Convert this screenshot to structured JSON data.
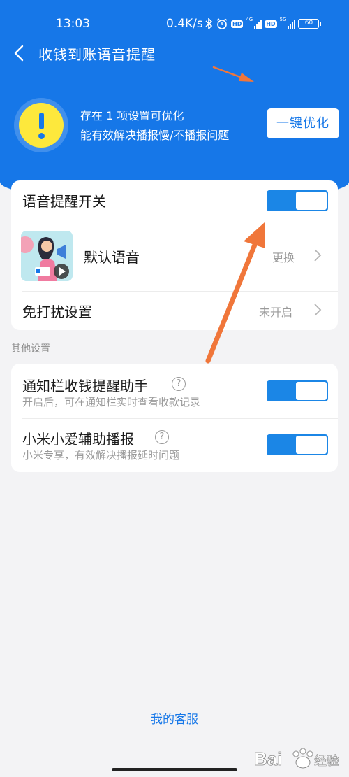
{
  "status_bar": {
    "time": "13:03",
    "speed": "0.4K/s",
    "network_1": "4G",
    "network_2": "5G",
    "hd_badge": "HD",
    "battery": "60"
  },
  "nav": {
    "title": "收钱到账语音提醒"
  },
  "alert": {
    "line1": "存在 1 项设置可优化",
    "line2": "能有效解决播报慢/不播报问题",
    "button_label": "一键优化"
  },
  "main_settings": {
    "voice_switch_label": "语音提醒开关",
    "voice_switch_on": true,
    "default_voice_label": "默认语音",
    "change_label": "更换",
    "dnd_label": "免打扰设置",
    "dnd_status": "未开启"
  },
  "other_settings": {
    "section_title": "其他设置",
    "items": [
      {
        "label": "通知栏收钱提醒助手",
        "sub": "开启后，可在通知栏实时查看收款记录",
        "on": true
      },
      {
        "label": "小米小爱辅助播报",
        "sub": "小米专享，有效解决播报延时问题",
        "on": true
      }
    ]
  },
  "footer": {
    "service_link": "我的客服"
  },
  "watermark": {
    "text": "Bai 经验"
  },
  "colors": {
    "brand_blue": "#1677e8",
    "toggle_blue": "#1b86e6",
    "warning_yellow": "#fde83c",
    "annotation_arrow": "#f0763a"
  },
  "icons": {
    "back": "chevron-left-icon",
    "warning": "exclamation-circle-icon",
    "chevron": "chevron-right-icon",
    "help": "question-circle-icon",
    "play": "play-icon"
  }
}
